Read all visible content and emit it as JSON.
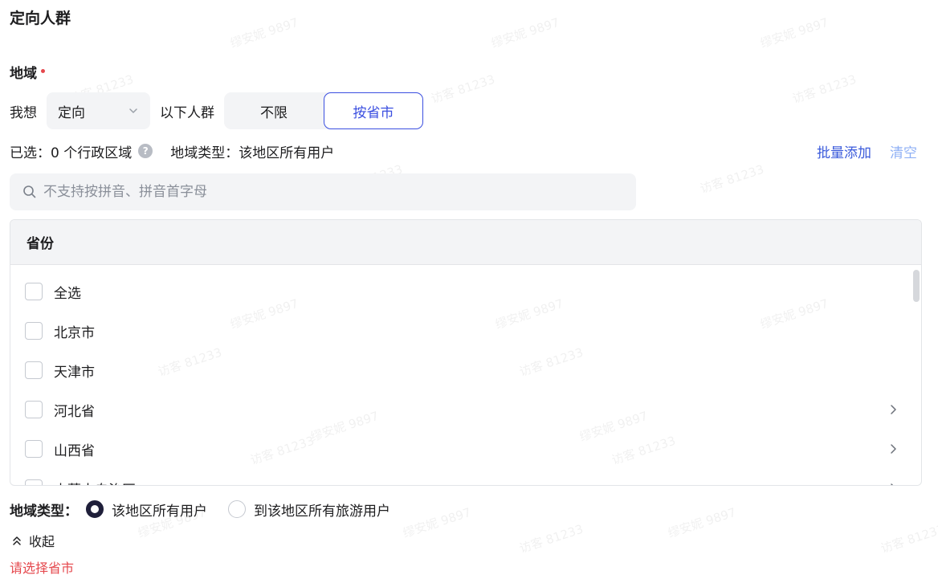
{
  "page": {
    "title": "定向人群"
  },
  "region": {
    "label": "地域"
  },
  "target_row": {
    "prefix": "我想",
    "select_value": "定向",
    "suffix": "以下人群",
    "segments": [
      {
        "label": "不限",
        "active": false
      },
      {
        "label": "按省市",
        "active": true
      }
    ]
  },
  "selected_row": {
    "selected_text": "已选：0 个行政区域",
    "type_text": "地域类型：该地区所有用户"
  },
  "actions": {
    "batch_add": "批量添加",
    "clear": "清空"
  },
  "search": {
    "placeholder": "不支持按拼音、拼音首字母"
  },
  "list": {
    "header": "省份",
    "items": [
      {
        "label": "全选",
        "has_children": false
      },
      {
        "label": "北京市",
        "has_children": false
      },
      {
        "label": "天津市",
        "has_children": false
      },
      {
        "label": "河北省",
        "has_children": true
      },
      {
        "label": "山西省",
        "has_children": true
      },
      {
        "label": "内蒙古自治区",
        "has_children": true
      }
    ]
  },
  "region_type": {
    "label": "地域类型：",
    "options": [
      {
        "label": "该地区所有用户",
        "checked": true
      },
      {
        "label": "到该地区所有旅游用户",
        "checked": false
      }
    ]
  },
  "collapse": {
    "label": "收起"
  },
  "error": {
    "message": "请选择省市"
  },
  "colors": {
    "accent": "#3b4fe0",
    "link": "#3b5bdb",
    "error": "#e5484d"
  },
  "watermarks": [
    "缪安妮 9897",
    "访客 81233"
  ]
}
